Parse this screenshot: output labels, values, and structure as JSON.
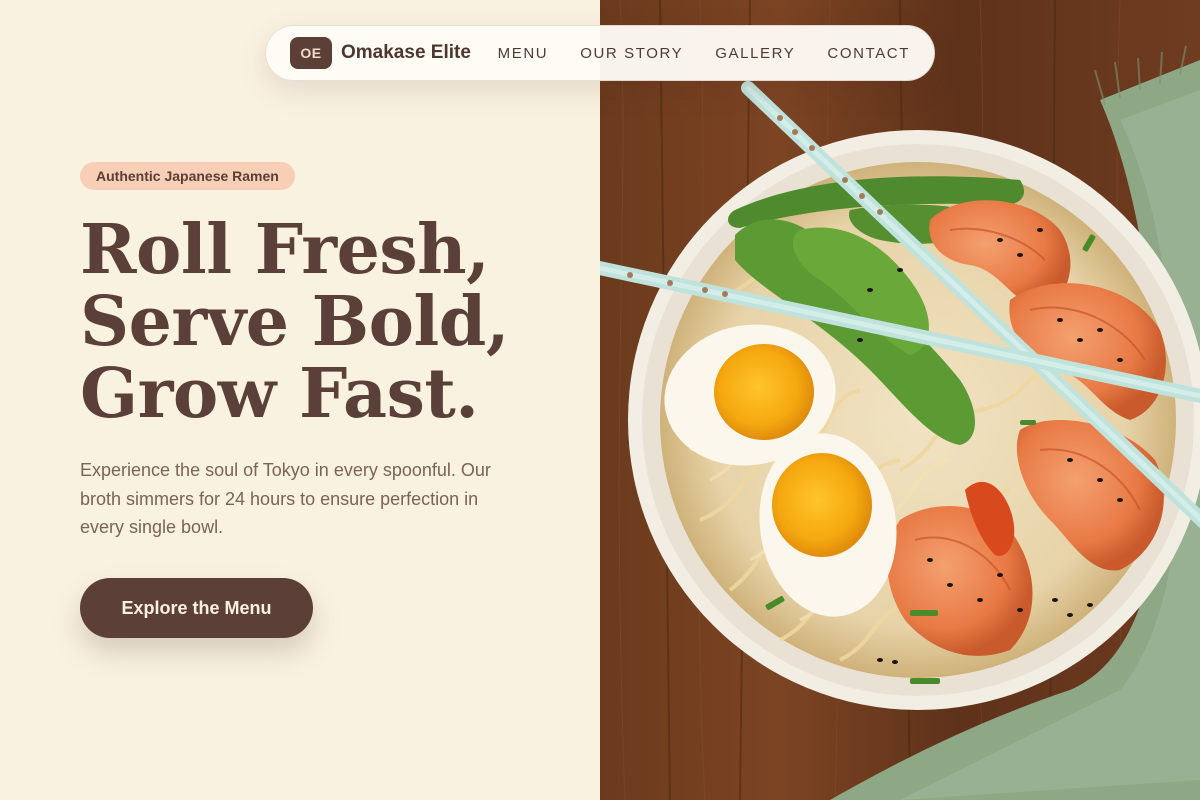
{
  "nav": {
    "logo_initials": "OE",
    "brand": "Omakase Elite",
    "links": [
      "MENU",
      "OUR STORY",
      "GALLERY",
      "CONTACT"
    ]
  },
  "hero": {
    "tag": "Authentic Japanese Ramen",
    "headline": [
      "Roll Fresh,",
      "Serve Bold,",
      "Grow Fast."
    ],
    "description": "Experience the soul of Tokyo in every spoonful. Our broth simmers for 24 hours to ensure perfection in every single bowl.",
    "cta": "Explore the Menu"
  },
  "colors": {
    "background": "#faf2e1",
    "primary": "#5c4038",
    "tag_background": "#f6cfb6",
    "text_muted": "#7a6358"
  },
  "image": {
    "subject": "ramen-bowl-photo"
  }
}
